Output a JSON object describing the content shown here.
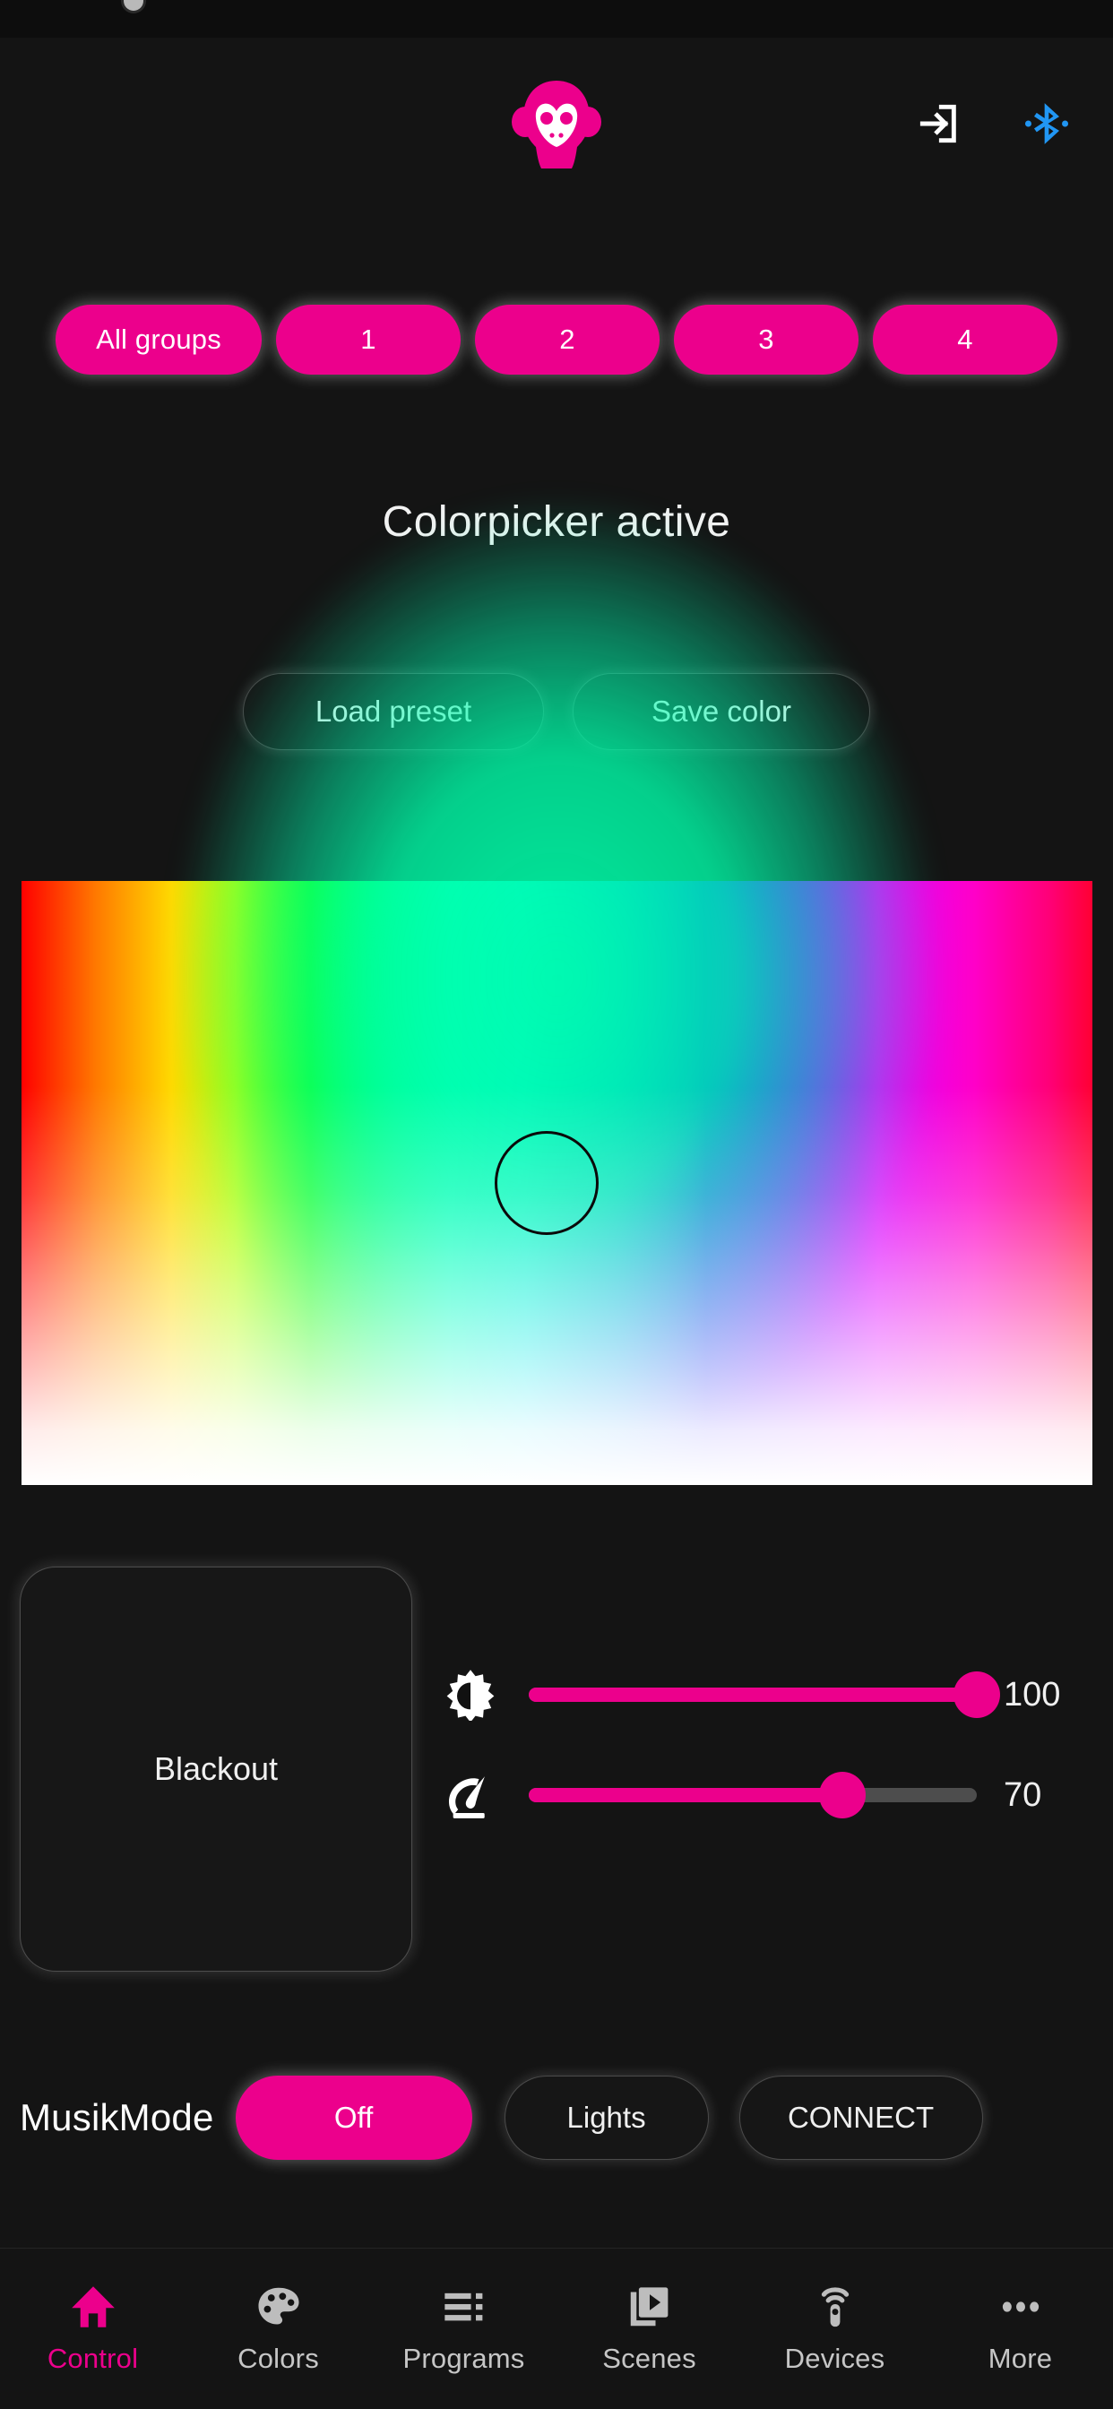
{
  "app": {
    "logo_icon": "monkey-head-logo",
    "accent_color": "#ec008c",
    "background_color": "#141414",
    "bluetooth_color": "#2196f3"
  },
  "header": {
    "login_icon": "login-arrow-icon",
    "bluetooth_icon": "bluetooth-icon"
  },
  "groups": {
    "items": [
      {
        "label": "All groups",
        "active": true
      },
      {
        "label": "1",
        "active": true
      },
      {
        "label": "2",
        "active": true
      },
      {
        "label": "3",
        "active": true
      },
      {
        "label": "4",
        "active": true
      }
    ]
  },
  "status": {
    "headline": "Colorpicker active"
  },
  "presets": {
    "load_label": "Load preset",
    "save_label": "Save color"
  },
  "colorpicker": {
    "selected_color": "#00f0d0",
    "thumb_x_pct": 49,
    "thumb_y_pct": 50
  },
  "controls": {
    "blackout_label": "Blackout",
    "brightness": {
      "icon": "brightness-icon",
      "value": "100",
      "percent": 100
    },
    "speed": {
      "icon": "speed-gauge-icon",
      "value": "70",
      "percent": 70
    }
  },
  "musikmode": {
    "label": "MusikMode",
    "state_label": "Off",
    "lights_label": "Lights",
    "connect_label": "CONNECT"
  },
  "bottomnav": {
    "items": [
      {
        "label": "Control",
        "icon": "home-icon",
        "active": true
      },
      {
        "label": "Colors",
        "icon": "palette-icon",
        "active": false
      },
      {
        "label": "Programs",
        "icon": "list-icon",
        "active": false
      },
      {
        "label": "Scenes",
        "icon": "slides-play-icon",
        "active": false
      },
      {
        "label": "Devices",
        "icon": "remote-icon",
        "active": false
      },
      {
        "label": "More",
        "icon": "ellipsis-icon",
        "active": false
      }
    ]
  }
}
